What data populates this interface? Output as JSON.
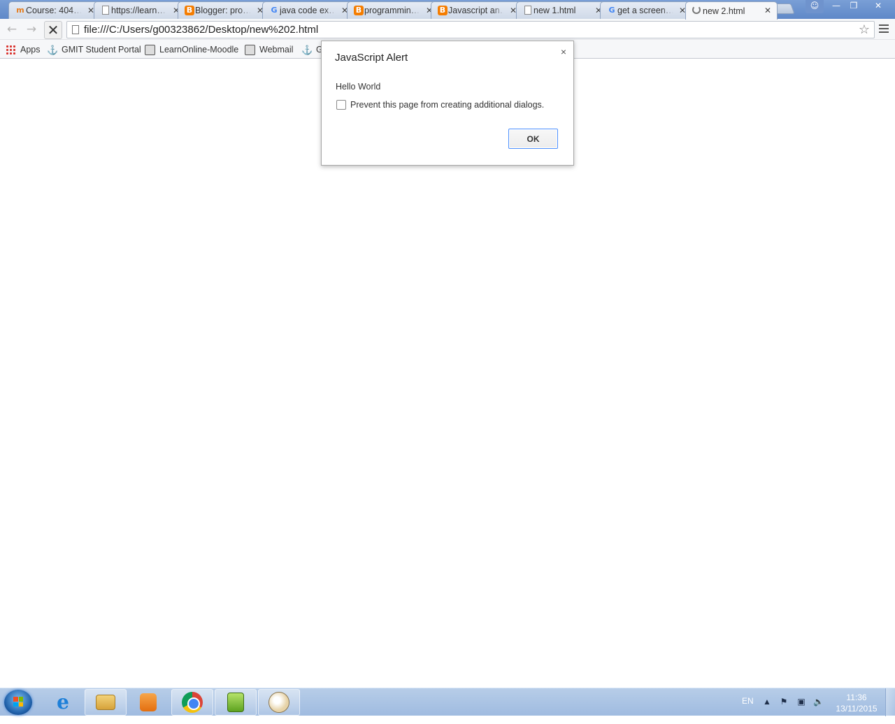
{
  "browser": {
    "tabs": [
      {
        "title": "Course: 404…",
        "favicon": "moodle-icon"
      },
      {
        "title": "https://learn…",
        "favicon": "document-icon"
      },
      {
        "title": "Blogger: pro…",
        "favicon": "blogger-icon"
      },
      {
        "title": "java code ex…",
        "favicon": "google-icon"
      },
      {
        "title": "programmin…",
        "favicon": "blogger-icon"
      },
      {
        "title": "Javascript an…",
        "favicon": "blogger-icon"
      },
      {
        "title": "new 1.html",
        "favicon": "document-icon"
      },
      {
        "title": "get a screen…",
        "favicon": "google-icon"
      },
      {
        "title": "new 2.html",
        "favicon": "loading-spinner-icon",
        "active": true
      }
    ],
    "address": "file:///C:/Users/g00323862/Desktop/new%202.html",
    "bookmarks": [
      {
        "label": "Apps"
      },
      {
        "label": "GMIT Student Portal"
      },
      {
        "label": "LearnOnline-Moodle"
      },
      {
        "label": "Webmail"
      },
      {
        "label": "G"
      }
    ]
  },
  "dialog": {
    "title": "JavaScript Alert",
    "message": "Hello World",
    "checkbox_label": "Prevent this page from creating additional dialogs.",
    "ok_label": "OK",
    "close_glyph": "×"
  },
  "taskbar": {
    "language": "EN",
    "time": "11:36",
    "date": "13/11/2015",
    "pinned": [
      "internet-explorer-icon",
      "windows-explorer-icon",
      "media-player-icon",
      "chrome-icon",
      "notepad-plus-plus-icon",
      "paint-icon"
    ]
  },
  "colors": {
    "tabstrip": "#6f93cd",
    "taskbar": "#a9c3e4",
    "ok_focus": "#4d90fe"
  }
}
